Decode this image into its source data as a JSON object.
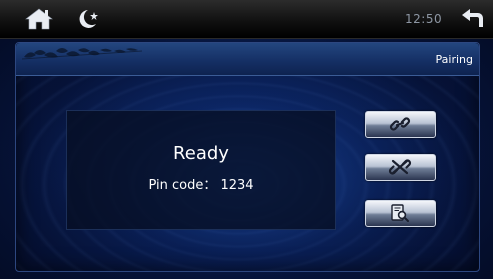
{
  "topbar": {
    "home_icon": "home-icon",
    "night_mode_icon": "moon-star-icon",
    "clock": "12:50",
    "back_icon": "back-arrow-icon"
  },
  "panel": {
    "title": "Pairing",
    "decoration": "leaf-silhouette"
  },
  "status": {
    "state": "Ready",
    "pin_label": "Pin code： 1234"
  },
  "actions": [
    {
      "name": "connect",
      "icon": "link-icon"
    },
    {
      "name": "disconnect",
      "icon": "unlink-icon"
    },
    {
      "name": "search-device",
      "icon": "search-device-icon"
    }
  ],
  "colors": {
    "background": "#0a1f52",
    "header": "#1a3a75",
    "button_light": "#f4f6fa",
    "button_dark": "#2b3550",
    "text": "#ffffff",
    "clock_text": "#8d96a3"
  }
}
